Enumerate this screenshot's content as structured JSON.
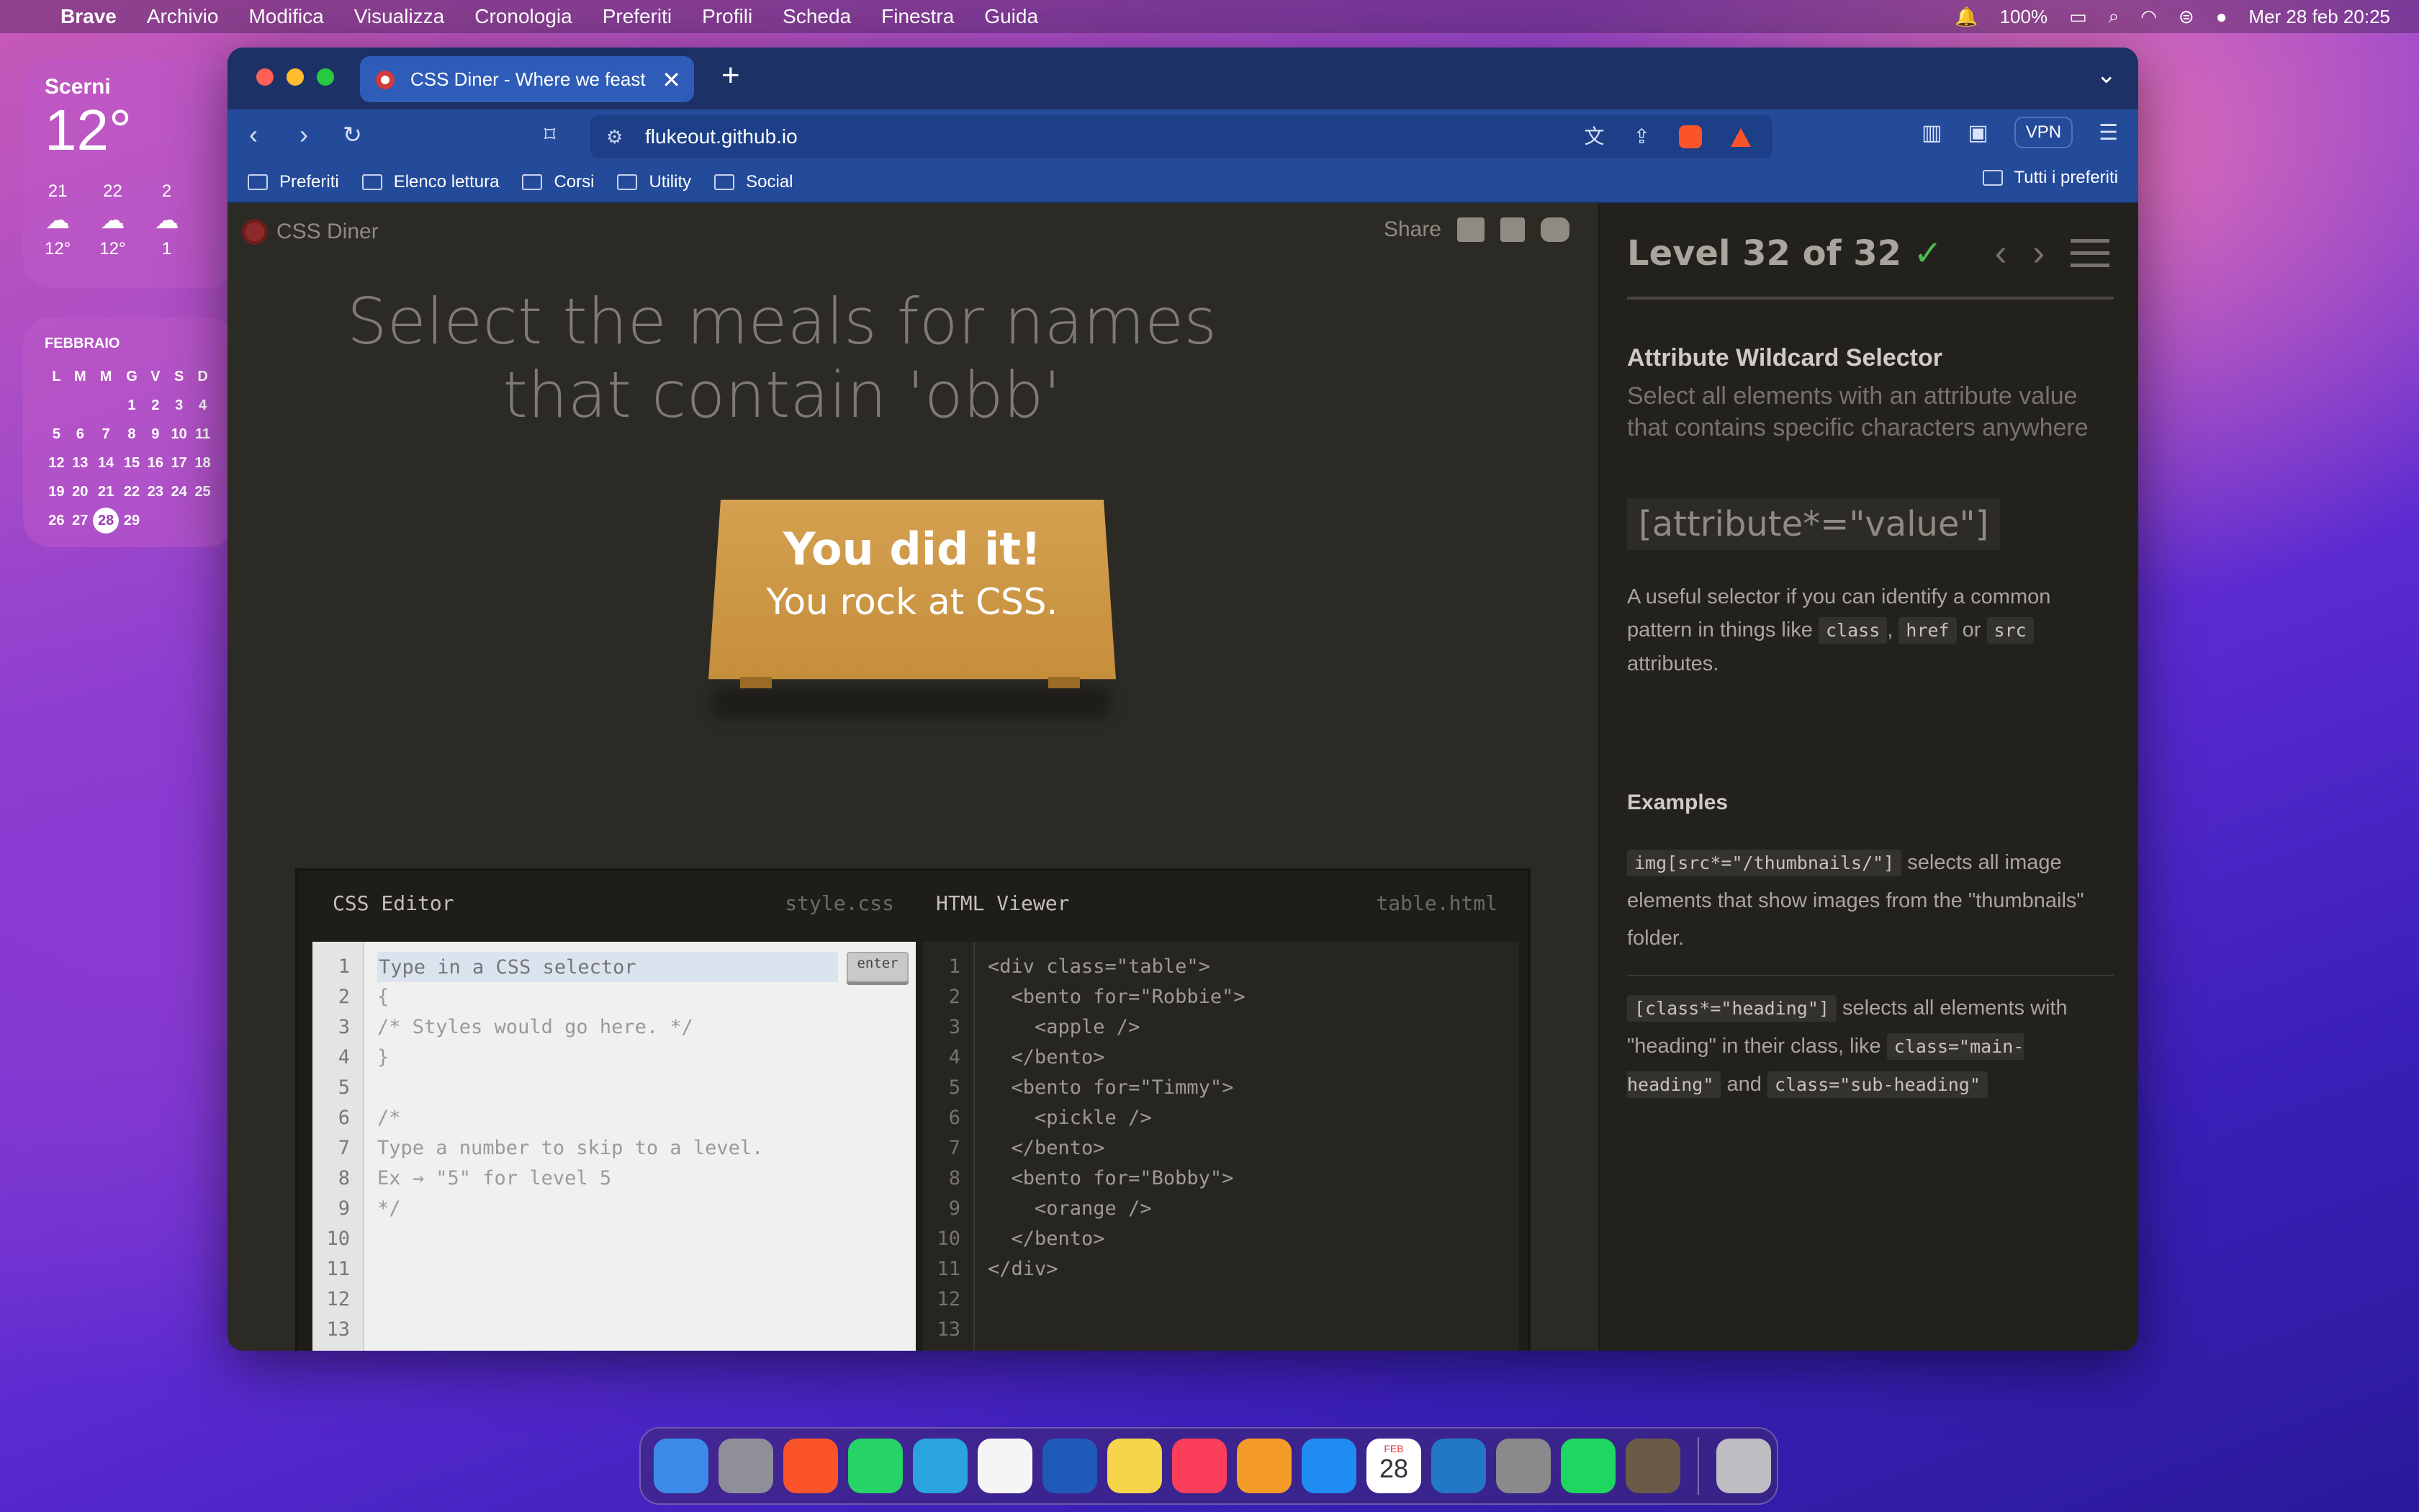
{
  "menubar": {
    "app": "Brave",
    "items": [
      "Archivio",
      "Modifica",
      "Visualizza",
      "Cronologia",
      "Preferiti",
      "Profili",
      "Scheda",
      "Finestra",
      "Guida"
    ],
    "battery": "100%",
    "datetime": "Mer 28 feb  20:25"
  },
  "weather": {
    "city": "Scerni",
    "temp": "12°",
    "hours": [
      {
        "h": "21",
        "t": "12°"
      },
      {
        "h": "22",
        "t": "12°"
      },
      {
        "h": "2",
        "t": "1"
      }
    ]
  },
  "calendar": {
    "month": "FEBBRAIO",
    "days_header": [
      "L",
      "M",
      "M",
      "G",
      "V",
      "S",
      "D"
    ],
    "weeks": [
      [
        "",
        "",
        "",
        "1",
        "2",
        "3",
        "4"
      ],
      [
        "5",
        "6",
        "7",
        "8",
        "9",
        "10",
        "11"
      ],
      [
        "12",
        "13",
        "14",
        "15",
        "16",
        "17",
        "18"
      ],
      [
        "19",
        "20",
        "21",
        "22",
        "23",
        "24",
        "25"
      ],
      [
        "26",
        "27",
        "28",
        "29",
        "",
        "",
        ""
      ]
    ],
    "today": "28"
  },
  "browser": {
    "tab_title": "CSS Diner - Where we feast on",
    "url": "flukeout.github.io",
    "vpn": "VPN",
    "bookmarks": [
      "Preferiti",
      "Elenco lettura",
      "Corsi",
      "Utility",
      "Social"
    ],
    "all_bookmarks": "Tutti i preferiti"
  },
  "game": {
    "logo": "CSS Diner",
    "share": "Share",
    "instruction": "Select the meals for names that contain 'obb'",
    "win_line1": "You did it!",
    "win_line2": "You rock at CSS.",
    "css_editor": {
      "title": "CSS Editor",
      "file": "style.css",
      "placeholder": "Type in a CSS selector",
      "enter": "enter",
      "lines": [
        "",
        "{",
        "/* Styles would go here. */",
        "}",
        "",
        "/*",
        "Type a number to skip to a level.",
        "Ex → \"5\" for level 5",
        "*/",
        "",
        "",
        "",
        "",
        ""
      ]
    },
    "html_viewer": {
      "title": "HTML Viewer",
      "file": "table.html",
      "lines": [
        "<div class=\"table\">",
        "  <bento for=\"Robbie\">",
        "    <apple />",
        "  </bento>",
        "  <bento for=\"Timmy\">",
        "    <pickle />",
        "  </bento>",
        "  <bento for=\"Bobby\">",
        "    <orange />",
        "  </bento>",
        "</div>",
        "",
        "",
        ""
      ]
    }
  },
  "sidebar": {
    "level": "Level 32 of 32",
    "check": "✓",
    "heading": "Attribute Wildcard Selector",
    "subtitle": "Select all elements with an attribute value that contains specific characters anywhere",
    "syntax": "[attribute*=\"value\"]",
    "desc_a": "A useful selector if you can identify a common pattern in things like",
    "code_class": "class",
    "comma": ",",
    "code_href": "href",
    "or": "or",
    "code_src": "src",
    "desc_b": "attributes.",
    "examples_title": "Examples",
    "ex1_code": "img[src*=\"/thumbnails/\"]",
    "ex1_text": "selects all image elements that show images from the \"thumbnails\" folder.",
    "ex2_code": "[class*=\"heading\"]",
    "ex2_text": "selects all elements with \"heading\" in their class, like",
    "ex2_code2": "class=\"main-heading\"",
    "and": "and",
    "ex2_code3": "class=\"sub-heading\""
  },
  "dock": {
    "apps": [
      "finder-icon",
      "launchpad-icon",
      "brave-icon",
      "whatsapp-icon",
      "telegram-icon",
      "photos-icon",
      "word-icon",
      "notes-icon",
      "music-icon",
      "pages-icon",
      "appstore-icon",
      "calendar-icon",
      "vscode-icon",
      "settings-icon",
      "spotify-icon",
      "preview-icon",
      "trash-icon"
    ],
    "calendar_month": "FEB",
    "calendar_day": "28"
  }
}
